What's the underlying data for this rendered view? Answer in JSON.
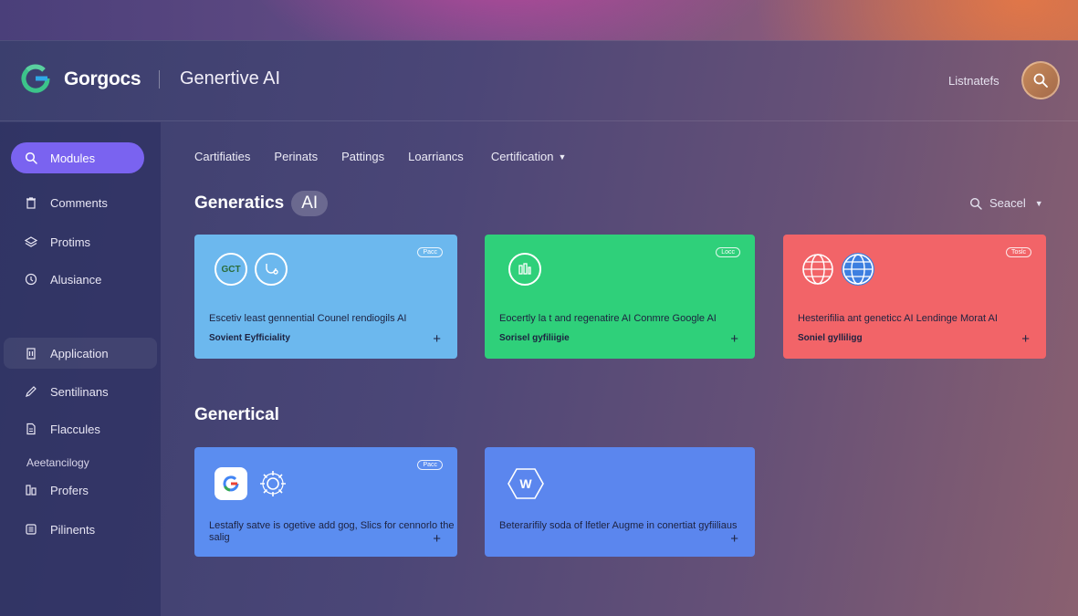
{
  "header": {
    "brand": "Gorgocs",
    "title": "Genertive AI",
    "right_label": "Listnatefs"
  },
  "sidebar": {
    "items": [
      {
        "label": "Modules",
        "icon": "search-icon"
      },
      {
        "label": "Comments",
        "icon": "trash-icon"
      },
      {
        "label": "Protims",
        "icon": "layers-icon"
      },
      {
        "label": "Alusiance",
        "icon": "clock-icon"
      },
      {
        "label": "Application",
        "icon": "building-icon"
      },
      {
        "label": "Sentilinans",
        "icon": "pencil-icon"
      },
      {
        "label": "Flaccules",
        "icon": "document-icon"
      },
      {
        "label": "Profers",
        "icon": "columns-icon"
      },
      {
        "label": "Pilinents",
        "icon": "list-icon"
      }
    ],
    "section_label": "Aeetancilogy"
  },
  "tabs": [
    "Cartifiaties",
    "Perinats",
    "Pattings",
    "Loarriancs",
    "Certification"
  ],
  "section1": {
    "title": "Generatics",
    "pill": "AI"
  },
  "section2": {
    "title": "Genertical"
  },
  "search": {
    "label": "Seacel"
  },
  "cards": [
    {
      "badge": "Pacc",
      "desc": "Escetiv least gennential Counel rendiogils AI",
      "sub": "Sovient Eyfficiality",
      "plus": "+",
      "color": "#6cb8ee",
      "icon_text": "GCT"
    },
    {
      "badge": "Locc",
      "desc": "Eocertly la t and regenatire AI Conmre Google AI",
      "sub": "Sorisel gyfiliigie",
      "plus": "+",
      "color": "#2fd07a"
    },
    {
      "badge": "Toslc",
      "desc": "Hesterifilia ant geneticc AI Lendinge Morat AI",
      "sub": "Soniel gylliligg",
      "plus": "+",
      "color": "#f26468"
    },
    {
      "badge": "Pacc",
      "desc": "Lestafly satve is ogetive add gog, Slics for cennorlo the salig",
      "plus": "+",
      "color": "#5b8df0"
    },
    {
      "desc": "Beterarifily soda of lfetler Augme in conertiat gyfiiliaus",
      "plus": "+",
      "color": "#5b86ee",
      "icon_text": "W"
    }
  ]
}
